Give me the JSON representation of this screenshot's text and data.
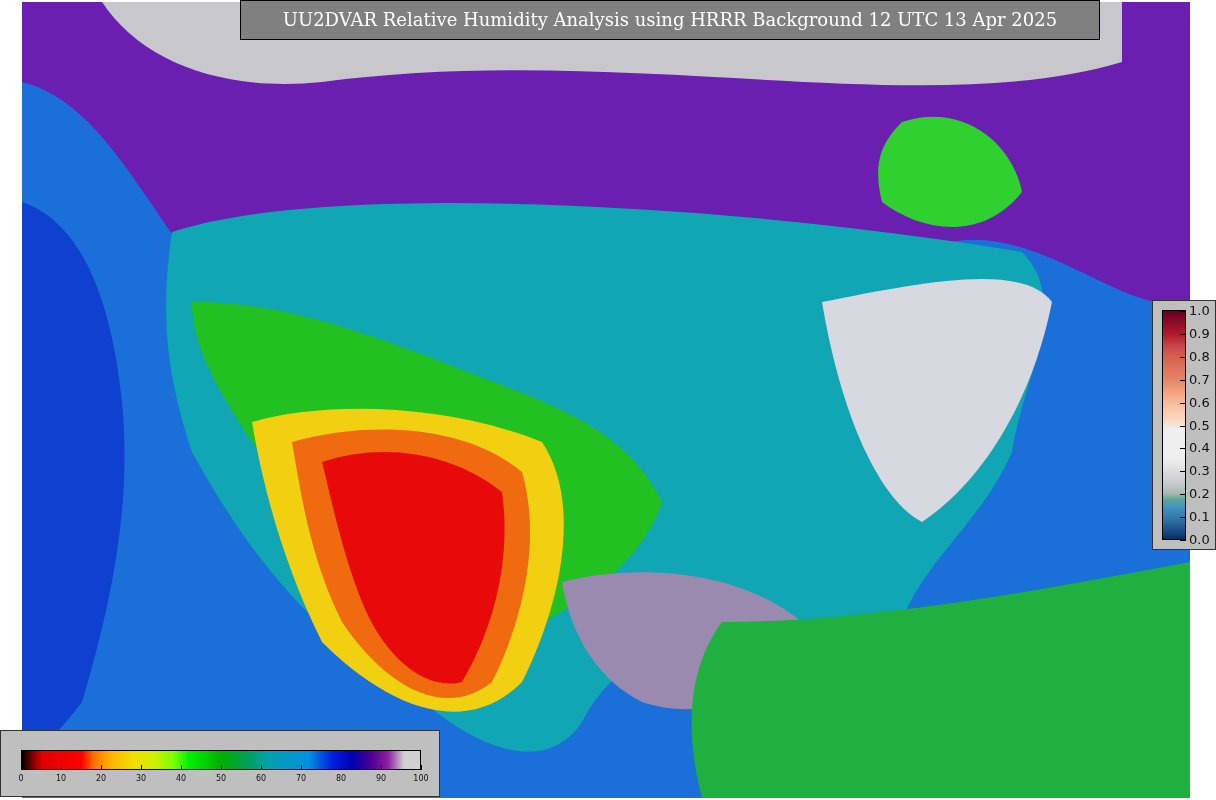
{
  "title": "UU2DVAR Relative Humidity Analysis using HRRR Background 12 UTC 13 Apr 2025",
  "weight_colorbar": {
    "ticks": [
      "1.0",
      "0.9",
      "0.8",
      "0.7",
      "0.6",
      "0.5",
      "0.4",
      "0.3",
      "0.2",
      "0.1",
      "0.0"
    ]
  },
  "humidity_colorbar": {
    "ticks": [
      "0",
      "10",
      "20",
      "30",
      "40",
      "50",
      "60",
      "70",
      "80",
      "90",
      "100"
    ]
  }
}
